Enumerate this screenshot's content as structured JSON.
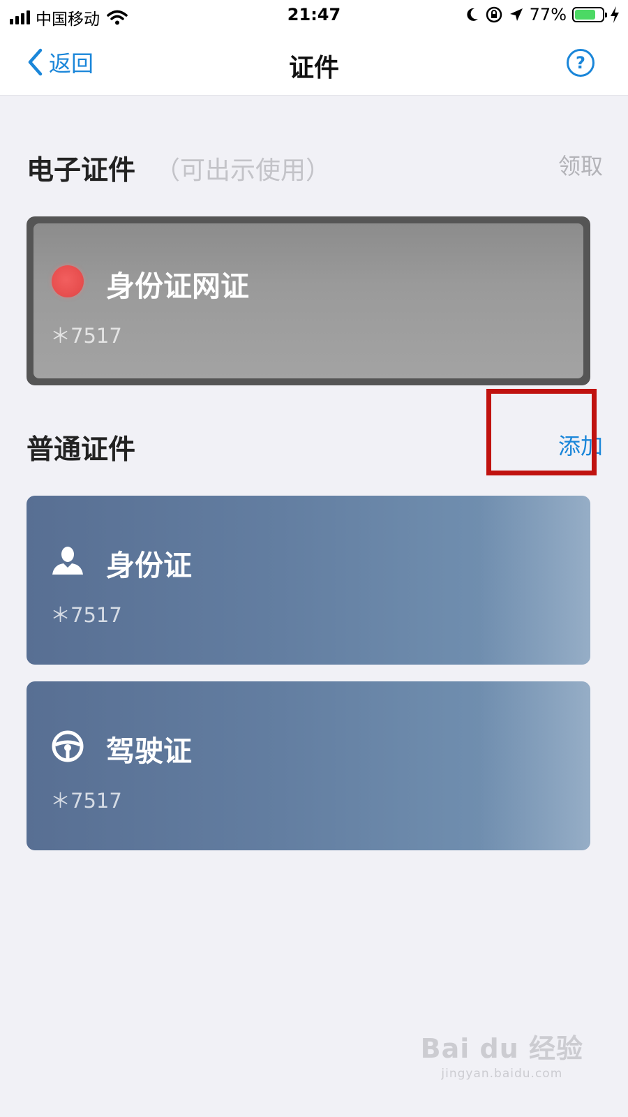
{
  "status_bar": {
    "carrier": "中国移动",
    "time": "21:47",
    "battery_pct": "77%",
    "battery_level": 0.77,
    "icons": [
      "signal-icon",
      "wifi-icon",
      "moon-icon",
      "rotation-lock-icon",
      "location-icon",
      "battery-icon",
      "charging-icon"
    ]
  },
  "nav": {
    "back_label": "返回",
    "title": "证件",
    "help_label": "?"
  },
  "electronic": {
    "title": "电子证件",
    "subtitle": "（可出示使用）",
    "action": "领取",
    "cards": [
      {
        "name": "身份证网证",
        "number": "＊7517",
        "icon": "red-dot-icon"
      }
    ]
  },
  "normal": {
    "title": "普通证件",
    "action": "添加",
    "cards": [
      {
        "name": "身份证",
        "number": "＊7517",
        "icon": "person-icon"
      },
      {
        "name": "驾驶证",
        "number": "＊7517",
        "icon": "steering-wheel-icon"
      }
    ]
  },
  "watermark": {
    "logo": "Bai du 经验",
    "url": "jingyan.baidu.com"
  },
  "colors": {
    "accent_blue": "#1a86d9",
    "highlight_red": "#c0120f",
    "background": "#f1f1f6",
    "card_blue": "#637ea1",
    "card_grey": "#9a9a9a"
  }
}
